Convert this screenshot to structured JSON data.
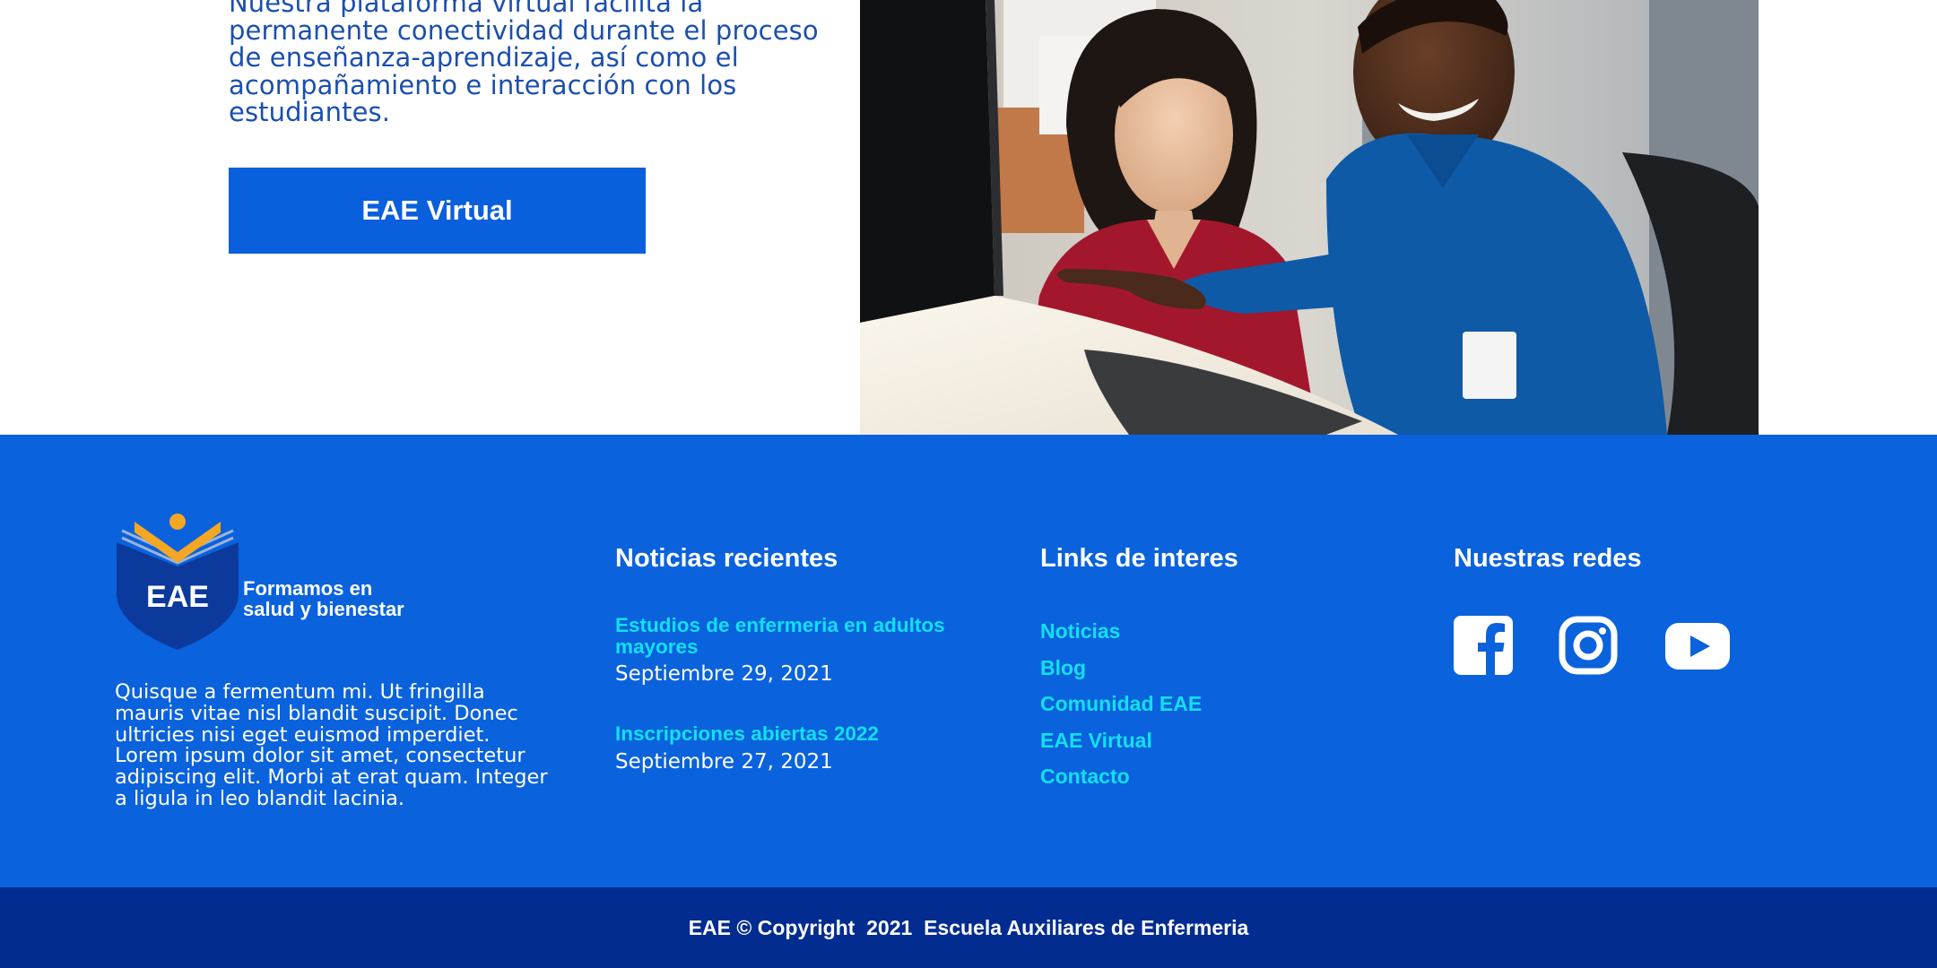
{
  "intro": {
    "text": "Nuestra plataforma virtual facilita la permanente conectividad durante el proceso de enseñanza-aprendizaje, así como el acompañamiento e interacción con los estudiantes.",
    "cta_label": "EAE Virtual"
  },
  "footer": {
    "logo_text": "EAE",
    "tagline_line1": "Formamos en",
    "tagline_line2": "salud y bienestar",
    "about": "Quisque a fermentum mi. Ut fringilla mauris vitae nisl blandit suscipit. Donec ultricies nisi eget euismod imperdiet. Lorem ipsum dolor sit amet, consectetur adipiscing elit. Morbi at erat quam. Integer a ligula in leo blandit lacinia.",
    "news": {
      "title": "Noticias recientes",
      "items": [
        {
          "title": "Estudios de enfermeria en adultos mayores",
          "date": "Septiembre 29, 2021"
        },
        {
          "title": "Inscripciones abiertas 2022",
          "date": "Septiembre 27, 2021"
        }
      ]
    },
    "links": {
      "title": "Links de interes",
      "items": [
        "Noticias",
        "Blog",
        "Comunidad EAE",
        "EAE Virtual",
        "Contacto"
      ]
    },
    "social": {
      "title": "Nuestras redes",
      "icons": [
        "facebook-icon",
        "instagram-icon",
        "youtube-icon"
      ]
    }
  },
  "bottom_bar": {
    "copyright": "EAE © Copyright  2021  Escuela Auxiliares de Enfermeria"
  },
  "colors": {
    "brand_blue": "#0a62dd",
    "button_blue": "#0a5fdd",
    "dark_blue": "#022c90",
    "link_cyan": "#12e0f0",
    "text_blue": "#1b4fae",
    "logo_orange": "#f5a623",
    "logo_navy": "#0b3a9c"
  }
}
